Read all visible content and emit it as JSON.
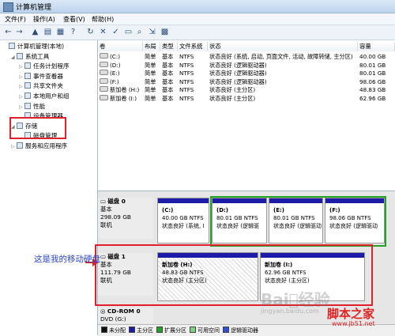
{
  "window": {
    "title": "计算机管理"
  },
  "menu": [
    "文件(F)",
    "操作(A)",
    "查看(V)",
    "帮助(H)"
  ],
  "toolbar": [
    {
      "icon": "back-arrow-icon",
      "glyph": "←"
    },
    {
      "icon": "forward-arrow-icon",
      "glyph": "→"
    },
    {
      "icon": "up-folder-icon",
      "glyph": "▲"
    },
    {
      "icon": "show-tree-icon",
      "glyph": "▤"
    },
    {
      "icon": "properties-icon",
      "glyph": "▦"
    },
    {
      "icon": "help-icon",
      "glyph": "?"
    },
    {
      "icon": "refresh-icon",
      "glyph": "↻"
    },
    {
      "icon": "delete-icon",
      "glyph": "✕"
    },
    {
      "icon": "check-icon",
      "glyph": "✓"
    },
    {
      "icon": "open-folder-icon",
      "glyph": "▭"
    },
    {
      "icon": "search-icon",
      "glyph": "⌕"
    },
    {
      "icon": "export-icon",
      "glyph": "⇲"
    },
    {
      "icon": "options-icon",
      "glyph": "▩"
    }
  ],
  "tree": [
    {
      "label": "计算机管理(本地)",
      "level": 0,
      "expander": "",
      "icon": "computer-icon"
    },
    {
      "label": "系统工具",
      "level": 1,
      "expander": "◢",
      "icon": "tools-icon"
    },
    {
      "label": "任务计划程序",
      "level": 2,
      "expander": "▷",
      "icon": "task-scheduler-icon"
    },
    {
      "label": "事件查看器",
      "level": 2,
      "expander": "▷",
      "icon": "event-viewer-icon"
    },
    {
      "label": "共享文件夹",
      "level": 2,
      "expander": "▷",
      "icon": "shared-folder-icon"
    },
    {
      "label": "本地用户和组",
      "level": 2,
      "expander": "▷",
      "icon": "users-icon"
    },
    {
      "label": "性能",
      "level": 2,
      "expander": "▷",
      "icon": "performance-icon"
    },
    {
      "label": "设备管理器",
      "level": 2,
      "expander": "",
      "icon": "device-manager-icon"
    },
    {
      "label": "存储",
      "level": 1,
      "expander": "◢",
      "icon": "storage-icon"
    },
    {
      "label": "磁盘管理",
      "level": 2,
      "expander": "",
      "icon": "disk-management-icon"
    },
    {
      "label": "服务和应用程序",
      "level": 1,
      "expander": "▷",
      "icon": "services-icon"
    }
  ],
  "list": {
    "columns": [
      "卷",
      "布局",
      "类型",
      "文件系统",
      "状态",
      "容量"
    ],
    "rows": [
      [
        "(C:)",
        "简单",
        "基本",
        "NTFS",
        "状态良好 (系统, 启动, 页面文件, 活动, 故障转储, 主分区)",
        "40.00 GB"
      ],
      [
        "(D:)",
        "简单",
        "基本",
        "NTFS",
        "状态良好 (逻辑驱动器)",
        "80.01 GB"
      ],
      [
        "(E:)",
        "简单",
        "基本",
        "NTFS",
        "状态良好 (逻辑驱动器)",
        "80.01 GB"
      ],
      [
        "(F:)",
        "简单",
        "基本",
        "NTFS",
        "状态良好 (逻辑驱动器)",
        "98.06 GB"
      ],
      [
        "新加卷 (H:)",
        "简单",
        "基本",
        "NTFS",
        "状态良好 (主分区)",
        "48.83 GB"
      ],
      [
        "新加卷 (I:)",
        "简单",
        "基本",
        "NTFS",
        "状态良好 (主分区)",
        "62.96 GB"
      ]
    ]
  },
  "disks": [
    {
      "name": "磁盘 0",
      "type": "基本",
      "size": "298.09 GB",
      "status": "联机",
      "partitions": [
        {
          "name": "(C:)",
          "size": "40.00 GB NTFS",
          "status": "状态良好 (系统, I",
          "bar_color": "#1c1ca8"
        },
        {
          "name": "(D:)",
          "size": "80.01 GB NTFS",
          "status": "状态良好 (逻辑驱",
          "bar_color": "#1c1ca8"
        },
        {
          "name": "(E:)",
          "size": "80.01 GB NTFS",
          "status": "状态良好 (逻辑驱动",
          "bar_color": "#1c1ca8"
        },
        {
          "name": "(F:)",
          "size": "98.06 GB NTFS",
          "status": "状态良好 (逻辑驱动",
          "bar_color": "#1c1ca8"
        }
      ]
    },
    {
      "name": "磁盘 1",
      "type": "基本",
      "size": "111.79 GB",
      "status": "联机",
      "partitions": [
        {
          "name": "新加卷  (H:)",
          "size": "48.83 GB NTFS",
          "status": "状态良好 (主分区)",
          "bar_color": "#1c1ca8"
        },
        {
          "name": "新加卷  (I:)",
          "size": "62.96 GB NTFS",
          "status": "状态良好 (主分区)",
          "bar_color": "#1c1ca8"
        }
      ]
    },
    {
      "name": "CD-ROM 0",
      "type": "DVD (G:)"
    }
  ],
  "legend": [
    {
      "label": "未分配",
      "color": "#111111"
    },
    {
      "label": "主分区",
      "color": "#1c1ca8"
    },
    {
      "label": "扩展分区",
      "color": "#23a323"
    },
    {
      "label": "可用空间",
      "color": "#7fd27f"
    },
    {
      "label": "逻辑驱动器",
      "color": "#2b4fd9"
    }
  ],
  "annotation": "这是我的移动硬盘",
  "watermarks": {
    "baidu": "Bai⃝经验",
    "site_cn": "脚本之家",
    "site_url": "www.jb51.net",
    "baidu_url": "jingyan.baidu.com"
  }
}
